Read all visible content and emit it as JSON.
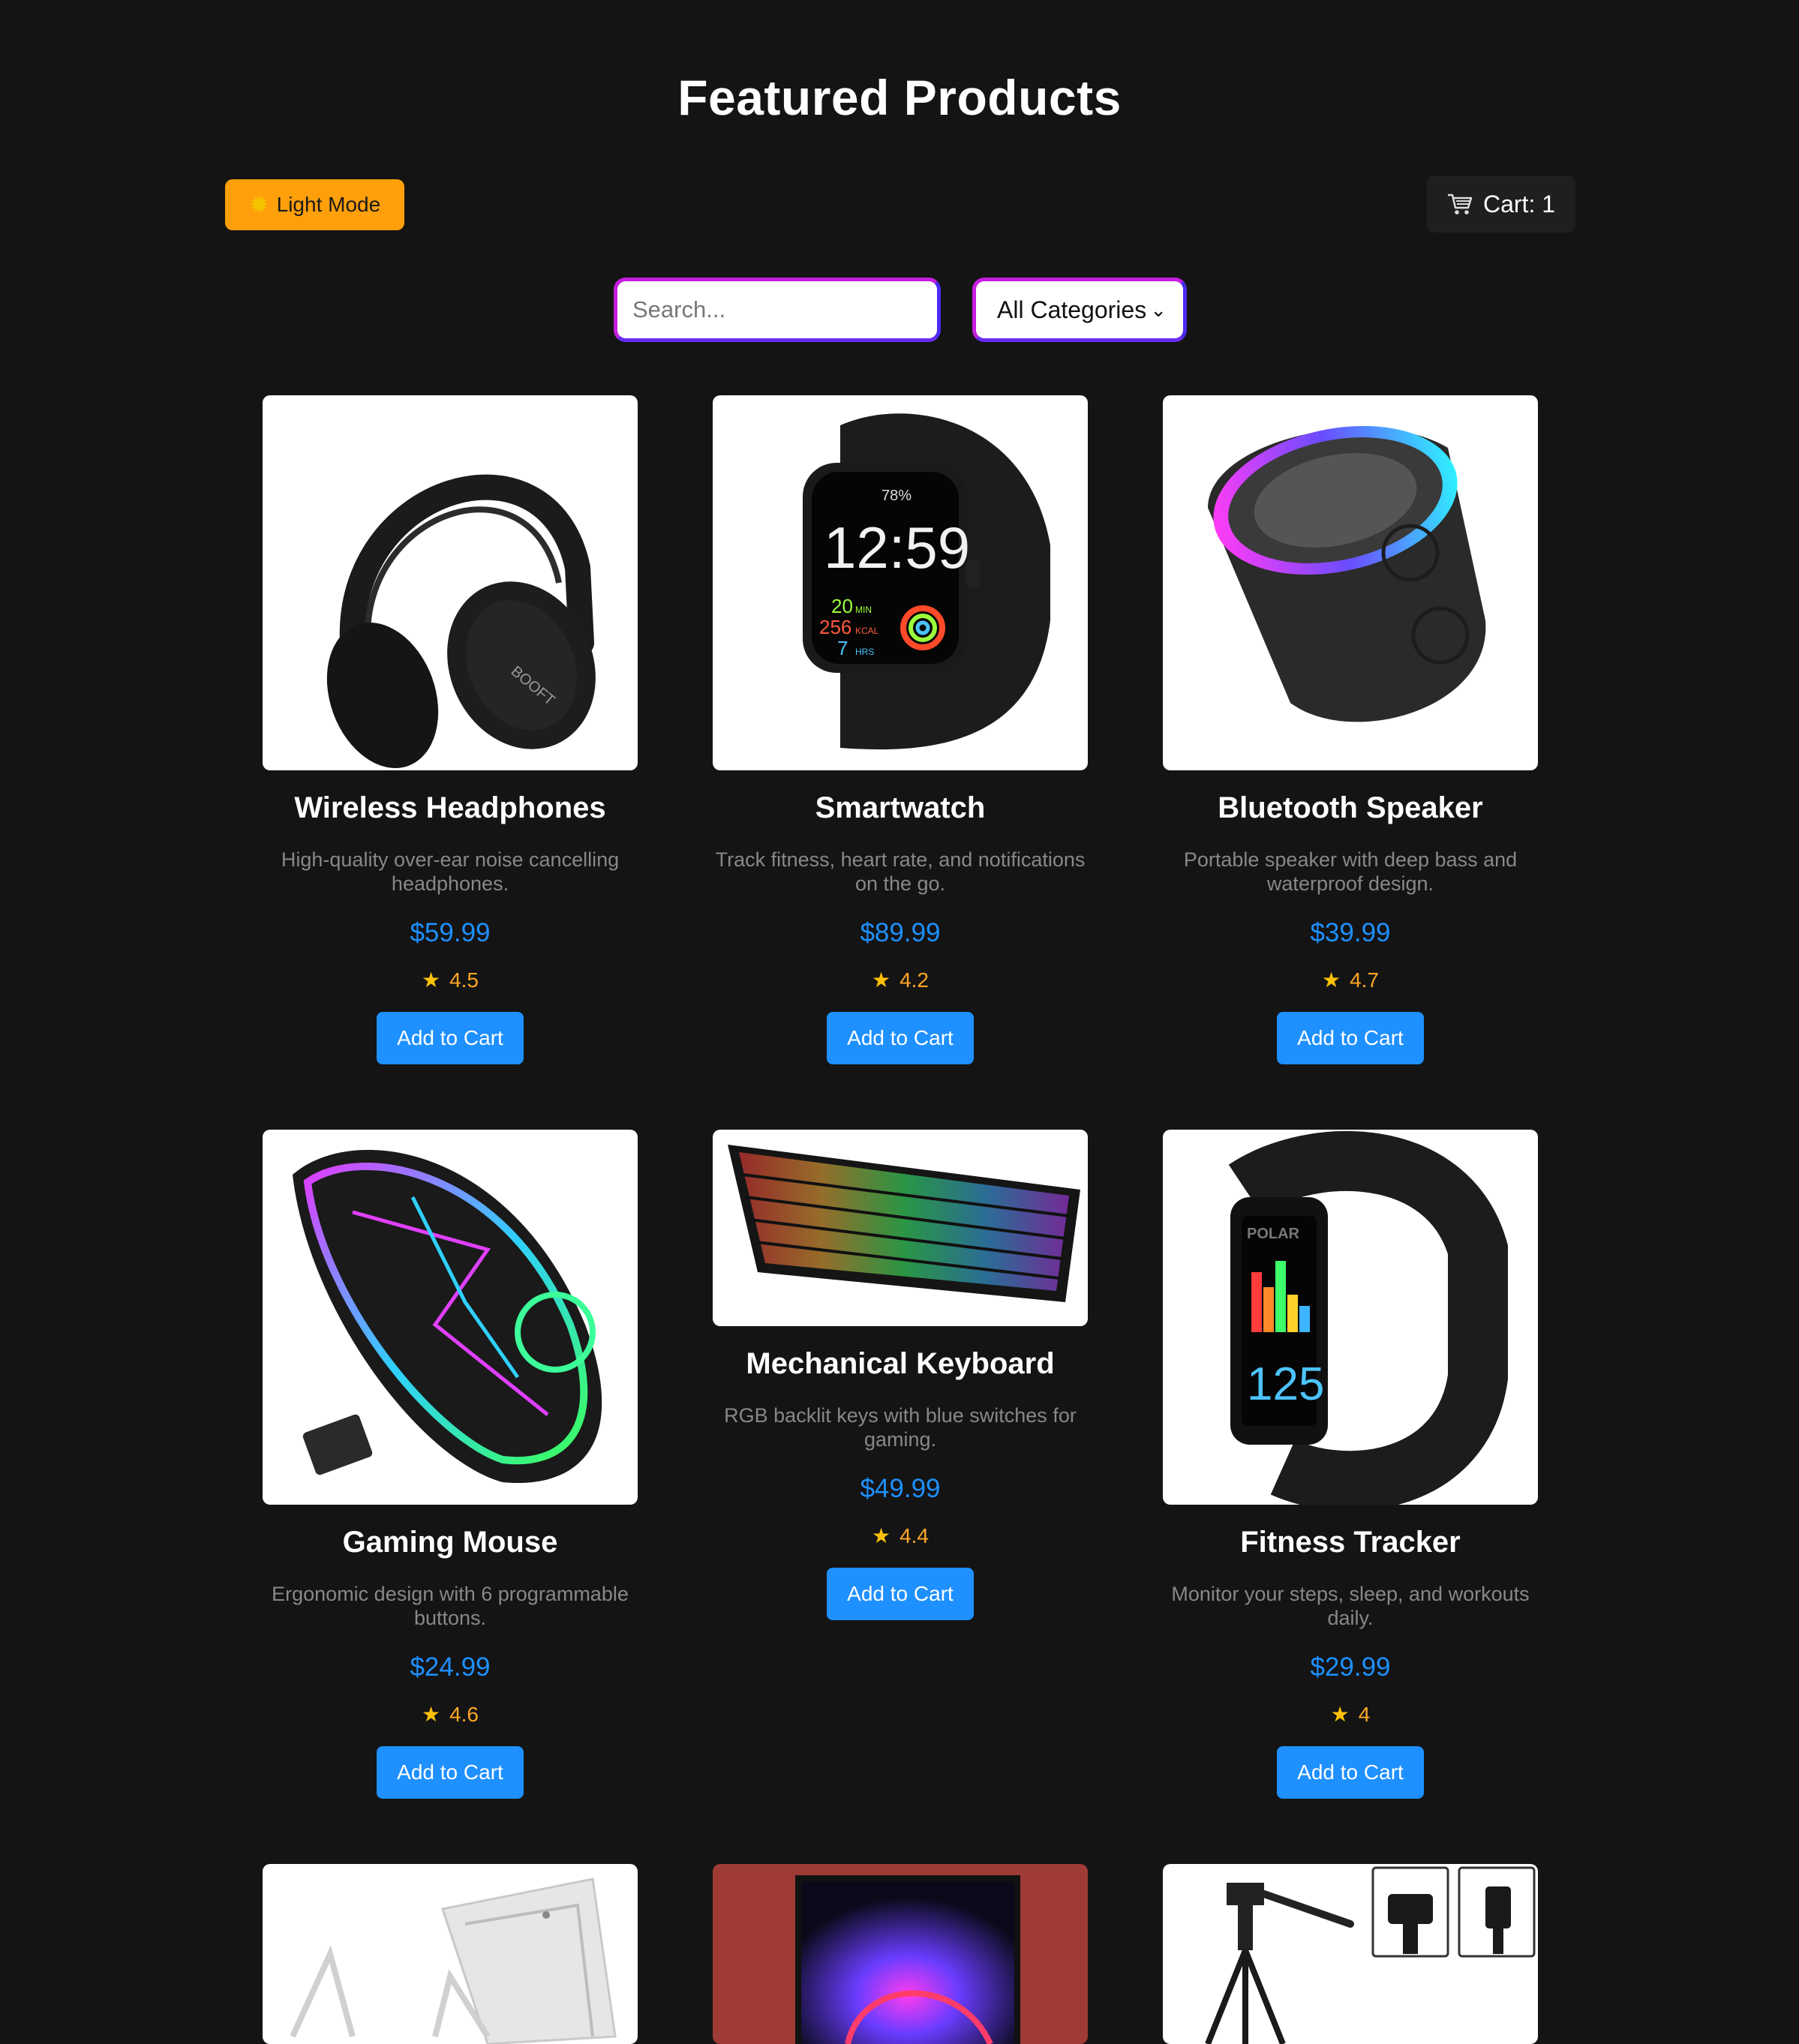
{
  "page": {
    "title": "Featured Products"
  },
  "toolbar": {
    "theme_toggle_label": "Light Mode",
    "cart_label": "Cart: 1"
  },
  "filters": {
    "search_placeholder": "Search...",
    "category_selected": "All Categories"
  },
  "colors": {
    "background": "#141414",
    "accent_orange": "#ff9f0a",
    "price_blue": "#1e90ff",
    "rating_orange": "#ffa726",
    "filter_border": "#c61de0"
  },
  "products": [
    {
      "name": "Wireless Headphones",
      "description": "High-quality over-ear noise cancelling headphones.",
      "price": "$59.99",
      "rating": "4.5",
      "button": "Add to Cart",
      "icon": "headphones-image"
    },
    {
      "name": "Smartwatch",
      "description": "Track fitness, heart rate, and notifications on the go.",
      "price": "$89.99",
      "rating": "4.2",
      "button": "Add to Cart",
      "icon": "smartwatch-image"
    },
    {
      "name": "Bluetooth Speaker",
      "description": "Portable speaker with deep bass and waterproof design.",
      "price": "$39.99",
      "rating": "4.7",
      "button": "Add to Cart",
      "icon": "speaker-image"
    },
    {
      "name": "Gaming Mouse",
      "description": "Ergonomic design with 6 programmable buttons.",
      "price": "$24.99",
      "rating": "4.6",
      "button": "Add to Cart",
      "icon": "mouse-image"
    },
    {
      "name": "Mechanical Keyboard",
      "description": "RGB backlit keys with blue switches for gaming.",
      "price": "$49.99",
      "rating": "4.4",
      "button": "Add to Cart",
      "icon": "keyboard-image"
    },
    {
      "name": "Fitness Tracker",
      "description": "Monitor your steps, sleep, and workouts daily.",
      "price": "$29.99",
      "rating": "4",
      "button": "Add to Cart",
      "icon": "fitness-tracker-image"
    }
  ],
  "image_text": {
    "watch_time": "12:59",
    "watch_stats": [
      "20",
      "256",
      "7"
    ],
    "watch_units": [
      "MIN",
      "KCAL",
      "HRS"
    ],
    "watch_battery": "78%",
    "tracker_brand": "POLAR",
    "tracker_reading": "125"
  }
}
